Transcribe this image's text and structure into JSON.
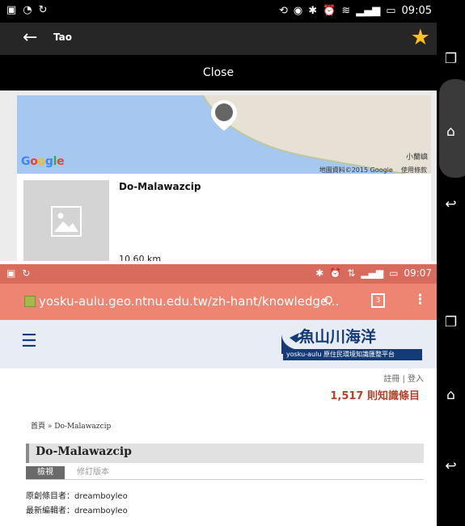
{
  "screen1": {
    "status_time": "09:05",
    "app_title": "Tao",
    "close_label": "Close",
    "map": {
      "place_label": "小蘭嶼",
      "copyright": "地圖資料©2015 Google",
      "terms": "使用條款",
      "google_letters": [
        {
          "ch": "G",
          "color": "#4285f4"
        },
        {
          "ch": "o",
          "color": "#ea4335"
        },
        {
          "ch": "o",
          "color": "#fbbc05"
        },
        {
          "ch": "g",
          "color": "#4285f4"
        },
        {
          "ch": "l",
          "color": "#34a853"
        },
        {
          "ch": "e",
          "color": "#ea4335"
        }
      ]
    },
    "place_name": "Do-Malawazcip",
    "distance": "10.60 km"
  },
  "screen2": {
    "status_time": "09:07",
    "url": "yosku-aulu.geo.ntnu.edu.tw/zh-hant/knowledge...",
    "tab_count": "3",
    "logo_title": "魚山川海洋",
    "logo_subtitle": "yosku-aulu 原住民環境知識匯整平台",
    "auth_links": "註冊 | 登入",
    "entry_count": "1,517 則知識條目",
    "breadcrumb": "首頁 » Do-Malawazcip",
    "node_title": "Do-Malawazcip",
    "tabs": [
      "檢視",
      "修訂版本"
    ],
    "creator": "原創條目者：dreamboyleo",
    "editor": "最新編輯者：dreamboyleo"
  },
  "colors": {
    "star": "#ffc21a",
    "browser_bar": "#ee8472",
    "status_bar_2": "#d96b5c",
    "logo_blue": "#143a78",
    "entry_count": "#b0442a"
  },
  "icons": {
    "nav_recent": "recent-apps-icon",
    "nav_home": "home-icon",
    "nav_back": "back-icon"
  }
}
